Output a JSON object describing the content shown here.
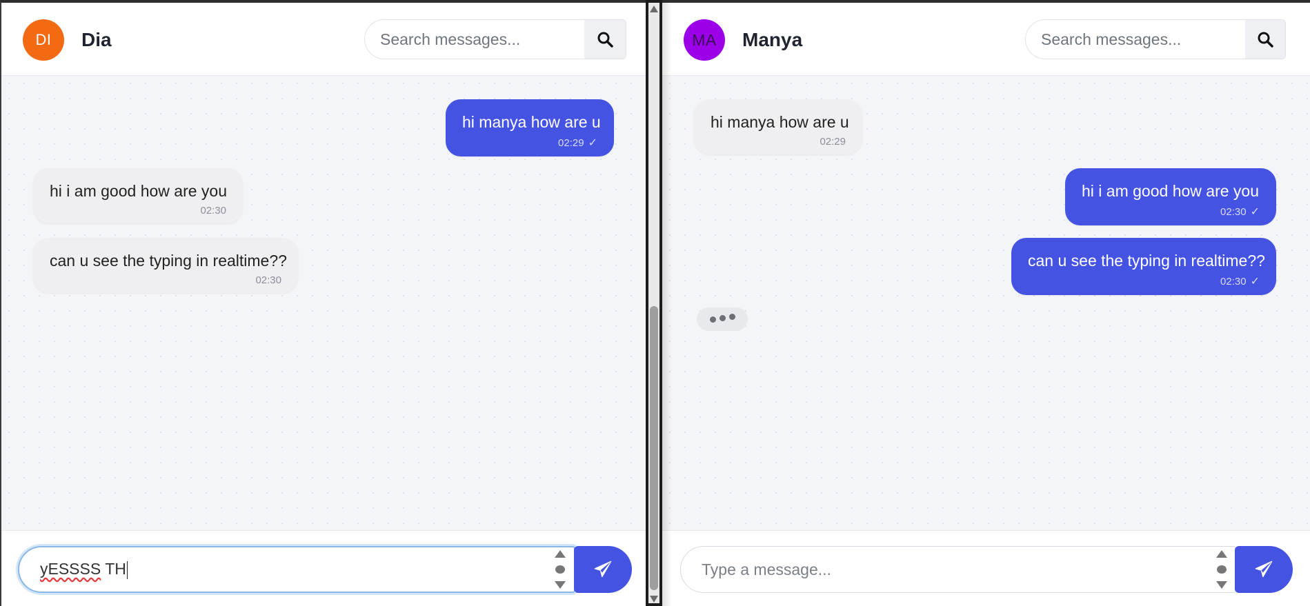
{
  "left_window": {
    "header": {
      "avatar_initials": "DI",
      "avatar_color": "#f26a12",
      "contact_name": "Dia",
      "search_placeholder": "Search messages..."
    },
    "messages": [
      {
        "direction": "outgoing",
        "text": "hi manya how are u",
        "time": "02:29",
        "status_icon": "check-icon"
      },
      {
        "direction": "incoming",
        "text": "hi i am good how are you",
        "time": "02:30"
      },
      {
        "direction": "incoming",
        "text": "can u see the typing in realtime??",
        "time": "02:30"
      }
    ],
    "composer": {
      "value_misspelled": "yESSSS",
      "value_rest": " TH",
      "send_icon": "paper-plane-icon"
    }
  },
  "right_window": {
    "header": {
      "avatar_initials": "MA",
      "avatar_color": "#9b00e8",
      "contact_name": "Manya",
      "search_placeholder": "Search messages..."
    },
    "messages": [
      {
        "direction": "incoming",
        "text": "hi manya how are u",
        "time": "02:29"
      },
      {
        "direction": "outgoing",
        "text": "hi i am good how are you",
        "time": "02:30",
        "status_icon": "check-icon"
      },
      {
        "direction": "outgoing",
        "text": "can u see the typing in realtime??",
        "time": "02:30",
        "status_icon": "check-icon"
      }
    ],
    "typing_indicator": true,
    "composer": {
      "placeholder": "Type a message...",
      "send_icon": "paper-plane-icon"
    }
  },
  "colors": {
    "outgoing_bubble": "#4553e3",
    "incoming_bubble": "#efeff1",
    "send_button": "#4553e3"
  }
}
